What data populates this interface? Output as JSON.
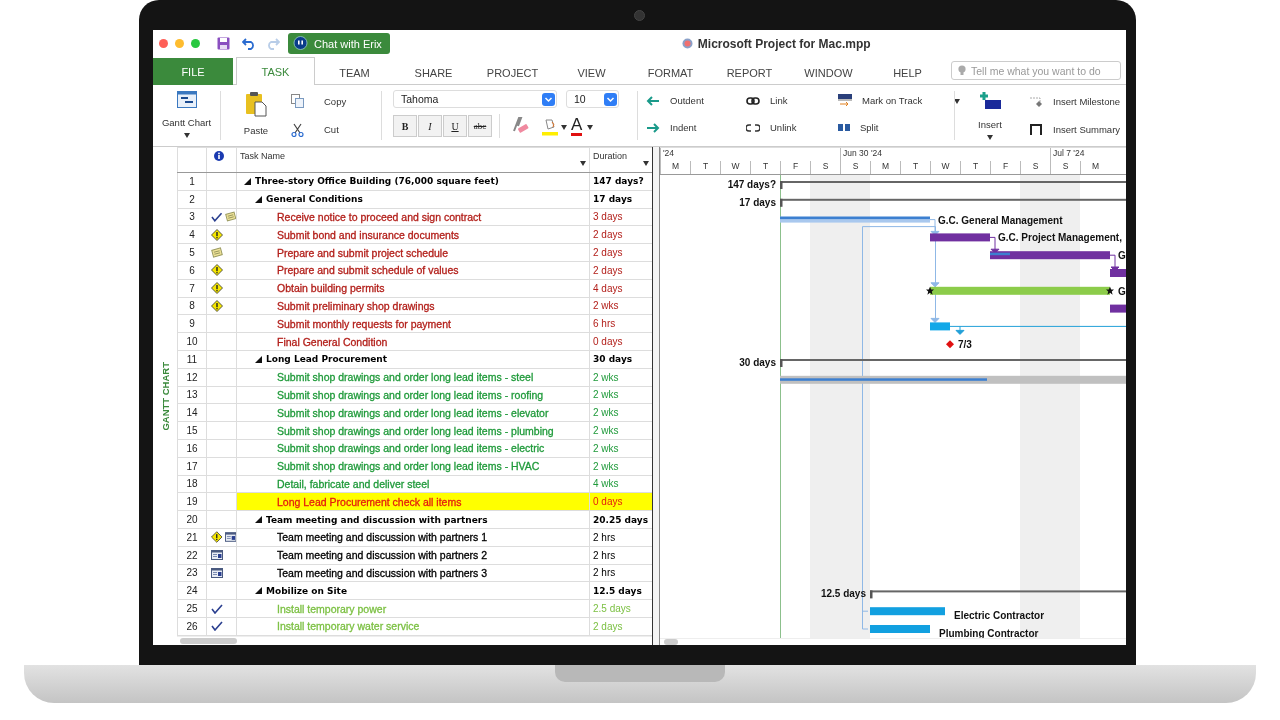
{
  "window": {
    "title": "Microsoft Project for Mac.mpp",
    "chat_button": "Chat with Erix"
  },
  "tabs": [
    {
      "label": "FILE",
      "kind": "file",
      "selected": false
    },
    {
      "label": "TASK",
      "kind": "tab",
      "selected": true
    },
    {
      "label": "TEAM",
      "kind": "tab",
      "selected": false
    },
    {
      "label": "SHARE",
      "kind": "tab",
      "selected": false
    },
    {
      "label": "PROJECT",
      "kind": "tab",
      "selected": false
    },
    {
      "label": "VIEW",
      "kind": "tab",
      "selected": false
    },
    {
      "label": "FORMAT",
      "kind": "tab",
      "selected": false
    },
    {
      "label": "REPORT",
      "kind": "tab",
      "selected": false
    },
    {
      "label": "WINDOW",
      "kind": "tab",
      "selected": false
    },
    {
      "label": "HELP",
      "kind": "tab",
      "selected": false
    }
  ],
  "search": {
    "placeholder": "Tell me what you want to do"
  },
  "ribbon": {
    "view_button": "Gantt Chart",
    "paste": "Paste",
    "copy": "Copy",
    "cut": "Cut",
    "font": "Tahoma",
    "font_size": "10",
    "format_buttons": [
      {
        "label": "B",
        "kind": "bold"
      },
      {
        "label": "I",
        "kind": "italic"
      },
      {
        "label": "U",
        "kind": "underline"
      },
      {
        "label": "abc",
        "kind": "strike"
      }
    ],
    "font_color_glyph": "A",
    "outdent": "Outdent",
    "indent": "Indent",
    "link": "Link",
    "unlink": "Unlink",
    "mark_on_track": "Mark on Track",
    "split": "Split",
    "insert": "Insert",
    "insert_milestone": "Insert Milestone",
    "insert_summary": "Insert Summary"
  },
  "side_label": "GANTT CHART",
  "table": {
    "columns": [
      "Task Name",
      "Duration"
    ],
    "rows": [
      {
        "id": "1",
        "name": "Three-story Office Building (76,000 square feet)",
        "duration": "147 days?",
        "color": "#000000",
        "highlighted": false,
        "expanded": true,
        "children": [
          {
            "id": "2",
            "name": "General Conditions",
            "duration": "17 days",
            "color": "#000000",
            "highlighted": false,
            "expanded": true,
            "children": [
              {
                "id": "3",
                "indicators": [
                  {
                    "kind": "check"
                  },
                  {
                    "kind": "note"
                  }
                ],
                "name": "Receive notice to proceed and sign contract",
                "duration": "3 days",
                "color": "#b3201b",
                "highlighted": false
              },
              {
                "id": "4",
                "indicators": [
                  {
                    "kind": "warning"
                  }
                ],
                "name": "Submit bond and insurance documents",
                "duration": "2 days",
                "color": "#b3201b",
                "highlighted": false
              },
              {
                "id": "5",
                "indicators": [
                  {
                    "kind": "note"
                  }
                ],
                "name": "Prepare and submit project schedule",
                "duration": "2 days",
                "color": "#b3201b",
                "highlighted": false
              },
              {
                "id": "6",
                "indicators": [
                  {
                    "kind": "warning"
                  }
                ],
                "name": "Prepare and submit schedule of values",
                "duration": "2 days",
                "color": "#b3201b",
                "highlighted": false
              },
              {
                "id": "7",
                "indicators": [
                  {
                    "kind": "warning"
                  }
                ],
                "name": "Obtain building permits",
                "duration": "4 days",
                "color": "#b3201b",
                "highlighted": false
              },
              {
                "id": "8",
                "indicators": [
                  {
                    "kind": "warning"
                  }
                ],
                "name": "Submit preliminary shop drawings",
                "duration": "2 wks",
                "color": "#b3201b",
                "highlighted": false
              },
              {
                "id": "9",
                "name": "Submit monthly requests for payment",
                "duration": "6 hrs",
                "color": "#b3201b",
                "highlighted": false
              },
              {
                "id": "10",
                "name": "Final General Condition",
                "duration": "0 days",
                "color": "#b3201b",
                "highlighted": false
              }
            ]
          },
          {
            "id": "11",
            "name": "Long Lead Procurement",
            "duration": "30 days",
            "color": "#000000",
            "highlighted": false,
            "expanded": true,
            "children": [
              {
                "id": "12",
                "name": "Submit shop drawings and order long lead items - steel",
                "duration": "2 wks",
                "color": "#1f9a3a",
                "highlighted": false
              },
              {
                "id": "13",
                "name": "Submit shop drawings and order long lead items - roofing",
                "duration": "2 wks",
                "color": "#1f9a3a",
                "highlighted": false
              },
              {
                "id": "14",
                "name": "Submit shop drawings and order long lead items - elevator",
                "duration": "2 wks",
                "color": "#1f9a3a",
                "highlighted": false
              },
              {
                "id": "15",
                "name": "Submit shop drawings and order long lead items - plumbing",
                "duration": "2 wks",
                "color": "#1f9a3a",
                "highlighted": false
              },
              {
                "id": "16",
                "name": "Submit shop drawings and order long lead items - electric",
                "duration": "2 wks",
                "color": "#1f9a3a",
                "highlighted": false
              },
              {
                "id": "17",
                "name": "Submit shop drawings and order long lead items - HVAC",
                "duration": "2 wks",
                "color": "#1f9a3a",
                "highlighted": false
              },
              {
                "id": "18",
                "name": "Detail, fabricate and deliver steel",
                "duration": "4 wks",
                "color": "#1f9a3a",
                "highlighted": false
              },
              {
                "id": "19",
                "name": "Long Lead Procurement check all items",
                "duration": "0 days",
                "color": "#e51c0e",
                "highlighted": true
              }
            ]
          },
          {
            "id": "20",
            "name": "Team meeting and discussion with partners",
            "duration": "20.25 days",
            "color": "#000000",
            "highlighted": false,
            "expanded": true,
            "children": [
              {
                "id": "21",
                "indicators": [
                  {
                    "kind": "warning"
                  },
                  {
                    "kind": "calendar"
                  }
                ],
                "name": "Team meeting and discussion with partners 1",
                "duration": "2 hrs",
                "color": "#000000",
                "highlighted": false
              },
              {
                "id": "22",
                "indicators": [
                  {
                    "kind": "calendar"
                  }
                ],
                "name": "Team meeting and discussion with partners 2",
                "duration": "2 hrs",
                "color": "#000000",
                "highlighted": false
              },
              {
                "id": "23",
                "indicators": [
                  {
                    "kind": "calendar"
                  }
                ],
                "name": "Team meeting and discussion with partners 3",
                "duration": "2 hrs",
                "color": "#000000",
                "highlighted": false
              }
            ]
          },
          {
            "id": "24",
            "name": "Mobilize on Site",
            "duration": "12.5 days",
            "color": "#000000",
            "highlighted": false,
            "expanded": true,
            "children": [
              {
                "id": "25",
                "indicators": [
                  {
                    "kind": "check"
                  }
                ],
                "name": "Install temporary power",
                "duration": "2.5 days",
                "color": "#7cc043",
                "highlighted": false
              },
              {
                "id": "26",
                "indicators": [
                  {
                    "kind": "check"
                  }
                ],
                "name": "Install temporary water service",
                "duration": "2 days",
                "color": "#7cc043",
                "highlighted": false
              }
            ]
          }
        ]
      }
    ]
  },
  "gantt": {
    "weeks": [
      "'24",
      "Jun 30 '24",
      "Jul 7 '24"
    ],
    "days": [
      "M",
      "T",
      "W",
      "T",
      "F",
      "S",
      "S",
      "M",
      "T",
      "W",
      "T",
      "F",
      "S",
      "S",
      "M"
    ],
    "bar_labels": [
      "147 days?",
      "17 days",
      "G.C. General Management",
      "G.C. Project Management,",
      "G",
      "G",
      "7/3",
      "30 days",
      "12.5 days",
      "Electric Contractor",
      "Plumbing Contractor"
    ]
  }
}
